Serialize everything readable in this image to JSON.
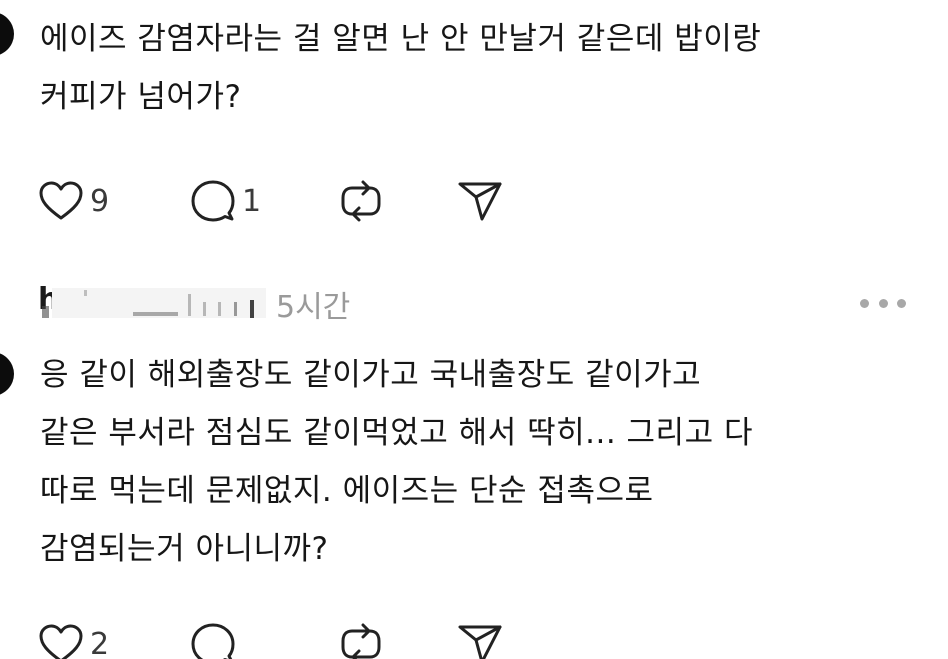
{
  "comment1": {
    "lines": [
      "에이즈 감염자라는 걸 알면 난 안 만날거 같은데 밥이랑",
      "커피가 넘어가?"
    ],
    "like_count": "9",
    "reply_count": "1"
  },
  "comment2": {
    "username_visible": "h",
    "timestamp": "5시간",
    "lines": [
      "응 같이 해외출장도 같이가고 국내출장도 같이가고",
      "같은 부서라 점심도 같이먹었고 해서 딱히... 그리고 다",
      "따로 먹는데 문제없지. 에이즈는 단순 접촉으로",
      "감염되는거 아니니까?"
    ],
    "like_count": "2"
  },
  "icons": {
    "like": "heart-icon",
    "reply": "speech-bubble-icon",
    "repost": "repost-icon",
    "share": "send-icon",
    "more": "more-icon"
  },
  "colors": {
    "text": "#161616",
    "muted": "#9a9a9a",
    "icon": "#222222"
  }
}
